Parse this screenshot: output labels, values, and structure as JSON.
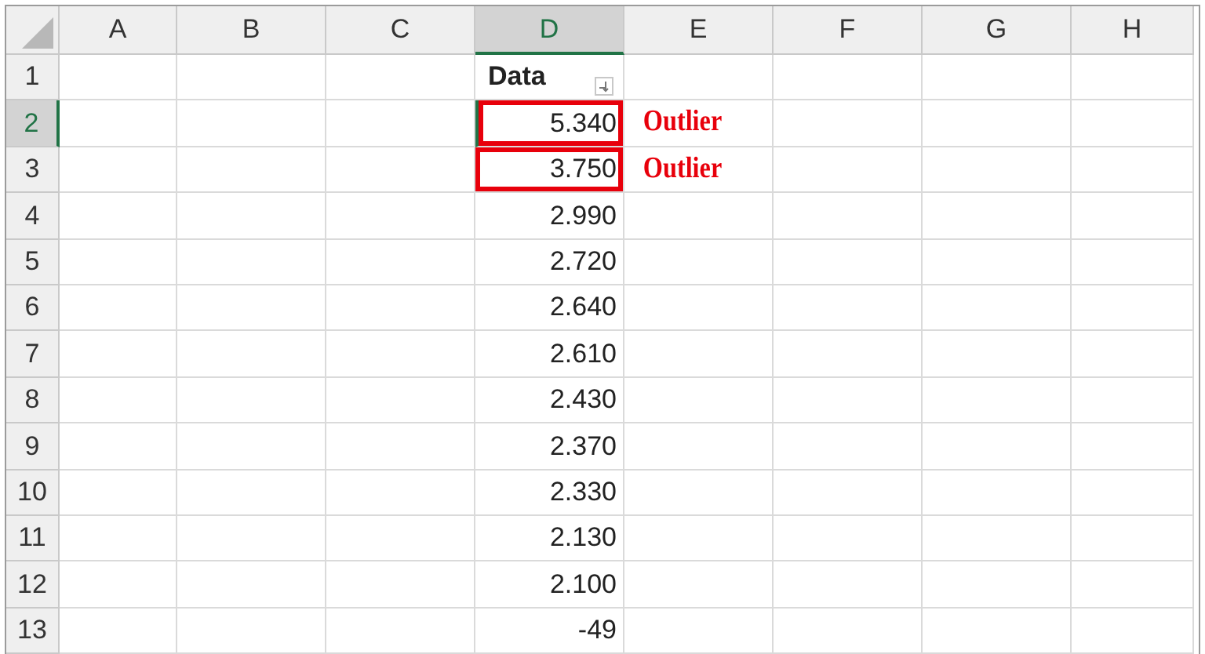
{
  "columns": [
    {
      "label": "A",
      "selected": false
    },
    {
      "label": "B",
      "selected": false
    },
    {
      "label": "C",
      "selected": false
    },
    {
      "label": "D",
      "selected": true
    },
    {
      "label": "E",
      "selected": false
    },
    {
      "label": "F",
      "selected": false
    },
    {
      "label": "G",
      "selected": false
    },
    {
      "label": "H",
      "selected": false
    }
  ],
  "rows": [
    {
      "number": "1",
      "selected": false,
      "kind": "header",
      "d": "Data",
      "filter": true,
      "outlier": false
    },
    {
      "number": "2",
      "selected": true,
      "kind": "value",
      "d": "5.340",
      "outlier": true,
      "note": "Outlier"
    },
    {
      "number": "3",
      "selected": false,
      "kind": "value",
      "d": "3.750",
      "outlier": true,
      "note": "Outlier"
    },
    {
      "number": "4",
      "selected": false,
      "kind": "value",
      "d": "2.990",
      "outlier": false
    },
    {
      "number": "5",
      "selected": false,
      "kind": "value",
      "d": "2.720",
      "outlier": false
    },
    {
      "number": "6",
      "selected": false,
      "kind": "value",
      "d": "2.640",
      "outlier": false
    },
    {
      "number": "7",
      "selected": false,
      "kind": "value",
      "d": "2.610",
      "outlier": false
    },
    {
      "number": "8",
      "selected": false,
      "kind": "value",
      "d": "2.430",
      "outlier": false
    },
    {
      "number": "9",
      "selected": false,
      "kind": "value",
      "d": "2.370",
      "outlier": false
    },
    {
      "number": "10",
      "selected": false,
      "kind": "value",
      "d": "2.330",
      "outlier": false
    },
    {
      "number": "11",
      "selected": false,
      "kind": "value",
      "d": "2.130",
      "outlier": false
    },
    {
      "number": "12",
      "selected": false,
      "kind": "value",
      "d": "2.100",
      "outlier": false
    },
    {
      "number": "13",
      "selected": false,
      "kind": "value",
      "d": "-49",
      "outlier": false
    }
  ]
}
